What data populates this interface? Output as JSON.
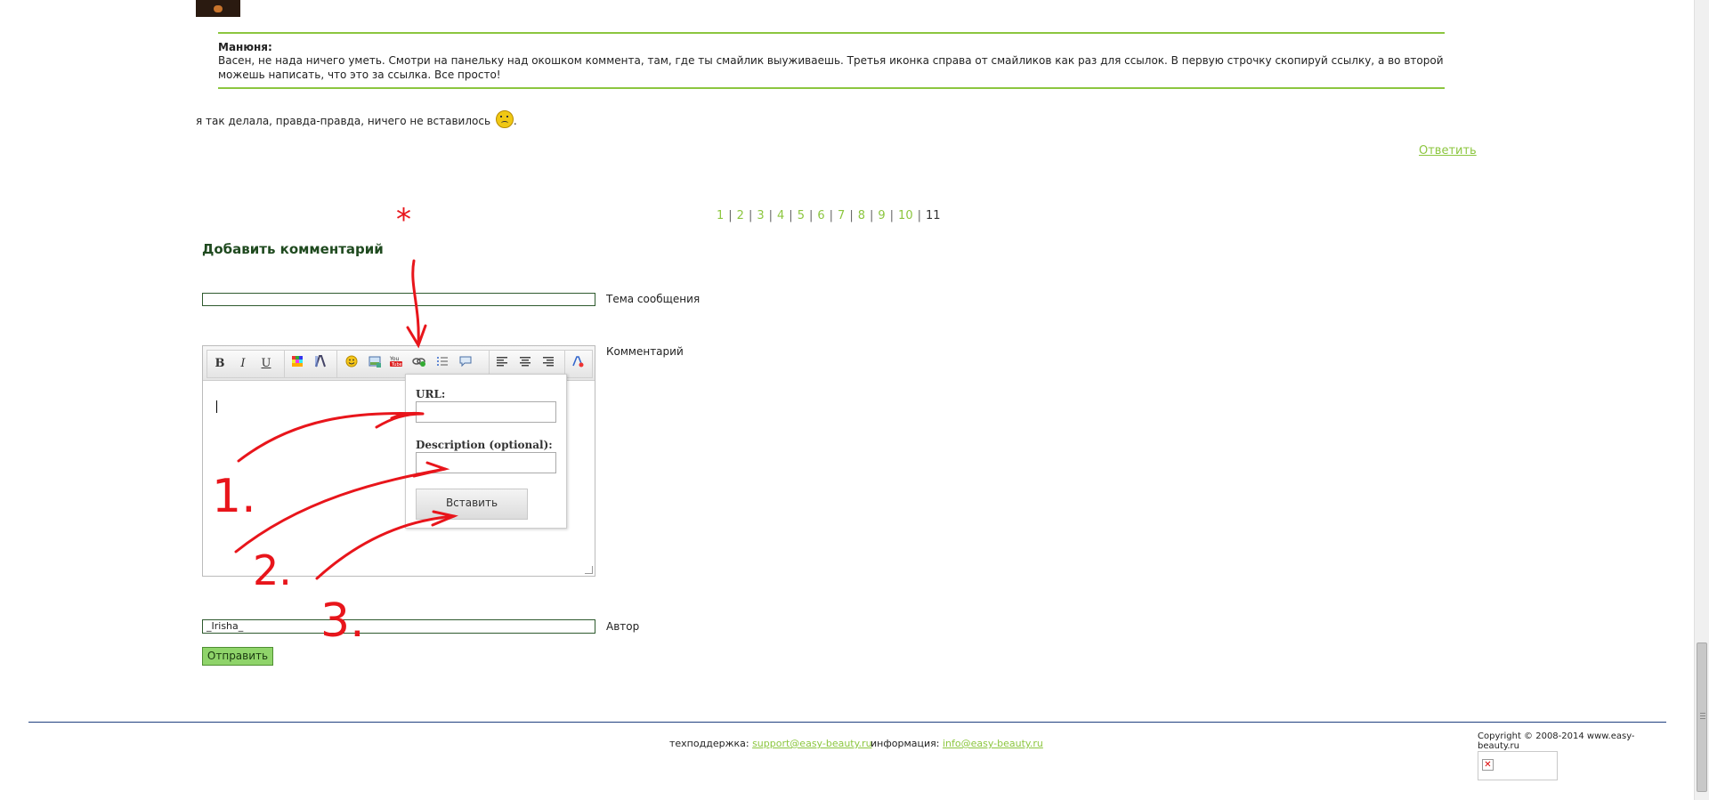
{
  "quote": {
    "author": "Манюня:",
    "text": "Васен, не нада ничего уметь. Смотри на панельку над окошком коммента, там, где ты смайлик выуживаешь. Третья иконка справа от смайликов как раз для ссылок. В первую строчку скопируй ссылку, а во второй можешь написать, что это за ссылка. Все просто!"
  },
  "reply": {
    "text": "я так делала, правда-правда, ничего не вставилось",
    "suffix": ".",
    "smiley_icon": "sad-smiley-icon"
  },
  "answer_link": "Ответить",
  "pagination": {
    "pages": [
      "1",
      "2",
      "3",
      "4",
      "5",
      "6",
      "7",
      "8",
      "9",
      "10"
    ],
    "current": "11",
    "separator": "|"
  },
  "form": {
    "heading": "Добавить комментарий",
    "subject_label": "Тема сообщения",
    "subject_value": "",
    "comment_label": "Комментарий",
    "author_label": "Автор",
    "author_value": "_Irisha_",
    "submit_label": "Отправить"
  },
  "toolbar": {
    "bold": "B",
    "italic": "I",
    "underline": "U",
    "icons": [
      "color-icon",
      "font-size-icon",
      "smiley-icon",
      "image-icon",
      "youtube-icon",
      "link-icon",
      "list-icon",
      "quote-icon",
      "align-left-icon",
      "align-center-icon",
      "align-right-icon",
      "remove-format-icon"
    ]
  },
  "link_popup": {
    "url_label": "URL:",
    "url_value": "",
    "desc_label": "Description (optional):",
    "desc_value": "",
    "insert_button": "Вставить"
  },
  "annotations": {
    "asterisk": "*",
    "step1": "1.",
    "step2": "2.",
    "step3": "3.",
    "color": "#e8151b"
  },
  "footer": {
    "support_label": "техподдержка:",
    "support_email": "support@easy-beauty.ru",
    "info_label": "информация:",
    "info_email": "info@easy-beauty.ru",
    "copyright": "Copyright © 2008-2014 www.easy-beauty.ru"
  },
  "colors": {
    "accent_green": "#8cc63f",
    "heading_green": "#1f4a1f",
    "footer_rule": "#1f3f7f"
  }
}
